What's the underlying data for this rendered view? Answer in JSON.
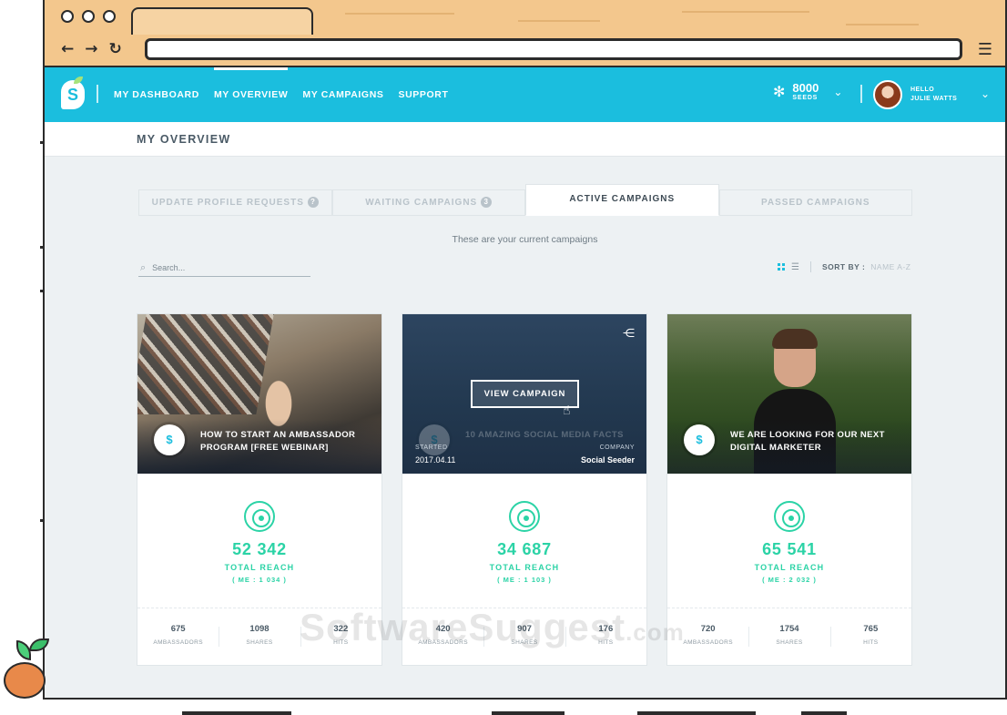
{
  "browser": {
    "back": "←",
    "forward": "→",
    "reload": "↻",
    "menu": "☰"
  },
  "app": {
    "logo_letter": "S",
    "nav": [
      "MY DASHBOARD",
      "MY OVERVIEW",
      "MY CAMPAIGNS",
      "SUPPORT"
    ],
    "active_nav": "MY OVERVIEW",
    "seeds": {
      "count": "8000",
      "label": "SEEDS"
    },
    "user": {
      "hello": "HELLO",
      "name": "JULIE WATTS"
    }
  },
  "page": {
    "title": "MY OVERVIEW",
    "tabs": [
      {
        "label": "UPDATE PROFILE REQUESTS",
        "badge": "?"
      },
      {
        "label": "WAITING CAMPAIGNS",
        "badge": "3"
      },
      {
        "label": "ACTIVE CAMPAIGNS",
        "badge": ""
      },
      {
        "label": "PASSED CAMPAIGNS",
        "badge": ""
      }
    ],
    "active_tab": "ACTIVE CAMPAIGNS",
    "caption": "These are your current campaigns",
    "search_placeholder": "Search...",
    "sort_label": "SORT BY :",
    "sort_value": "NAME A-Z"
  },
  "cards": [
    {
      "title": "HOW TO START AN AMBASSADOR PROGRAM [FREE WEBINAR]",
      "reach": "52 342",
      "reach_label": "TOTAL REACH",
      "me": "( ME : 1 034 )",
      "ambassadors": "675",
      "shares": "1098",
      "hits": "322"
    },
    {
      "title": "10 AMAZING SOCIAL MEDIA FACTS",
      "button": "VIEW CAMPAIGN",
      "started_label": "STARTED",
      "started": "2017.04.11",
      "company_label": "COMPANY",
      "company": "Social Seeder",
      "reach": "34 687",
      "reach_label": "TOTAL REACH",
      "me": "( ME : 1 103 )",
      "ambassadors": "420",
      "shares": "907",
      "hits": "176"
    },
    {
      "title": "WE ARE LOOKING FOR OUR NEXT DIGITAL MARKETER",
      "reach": "65 541",
      "reach_label": "TOTAL REACH",
      "me": "( ME : 2 032 )",
      "ambassadors": "720",
      "shares": "1754",
      "hits": "765"
    }
  ],
  "stat_labels": {
    "ambassadors": "AMBASSADORS",
    "shares": "SHARES",
    "hits": "HITS"
  },
  "watermark": {
    "text": "SoftwareSuggest",
    "suffix": ".com"
  },
  "colors": {
    "primary": "#1bbede",
    "accent": "#2bd3a6",
    "frame": "#f3c78d"
  }
}
